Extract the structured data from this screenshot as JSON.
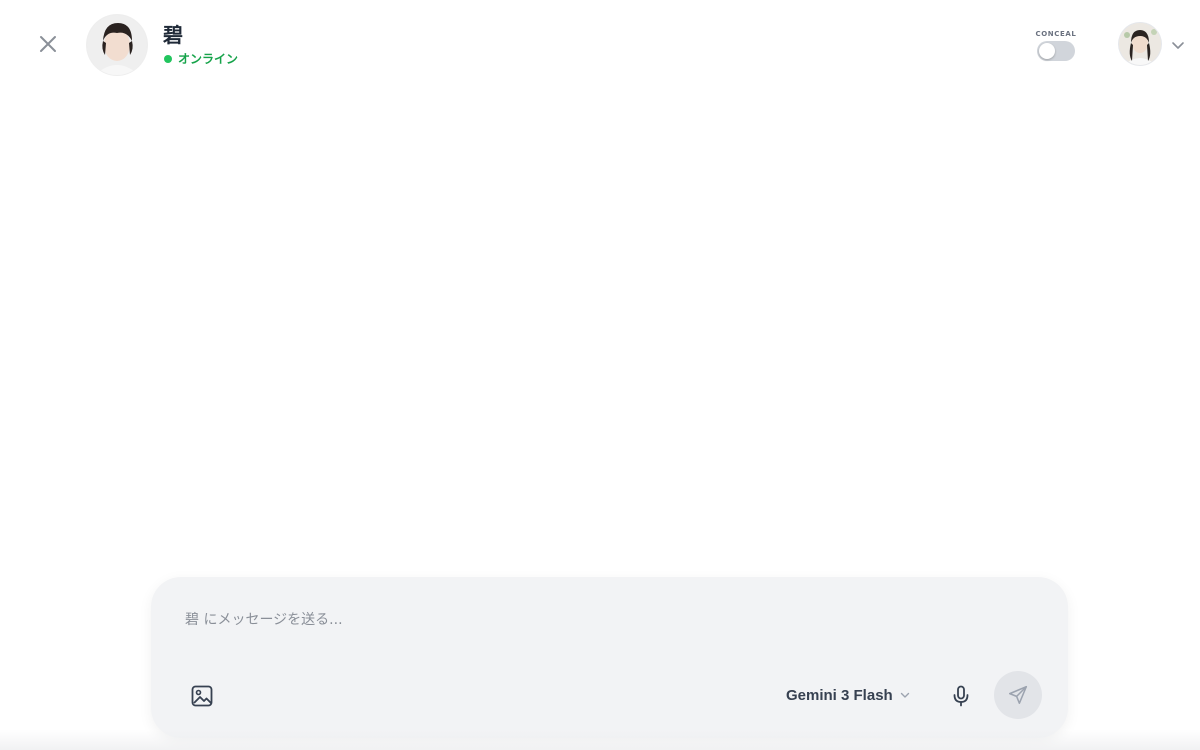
{
  "header": {
    "close_icon": "close-icon",
    "character": {
      "name": "碧",
      "status": "オンライン",
      "status_color": "#22c55e",
      "avatar_icon": "character-avatar"
    },
    "conceal": {
      "label": "CONCEAL",
      "enabled": false
    },
    "user": {
      "avatar_icon": "user-avatar",
      "menu_icon": "chevron-down-icon"
    }
  },
  "composer": {
    "placeholder": "碧 にメッセージを送る...",
    "value": "",
    "image_icon": "image-icon",
    "model": {
      "selected": "Gemini 3 Flash",
      "icon": "chevron-down-icon"
    },
    "mic_icon": "microphone-icon",
    "send_icon": "send-icon"
  }
}
